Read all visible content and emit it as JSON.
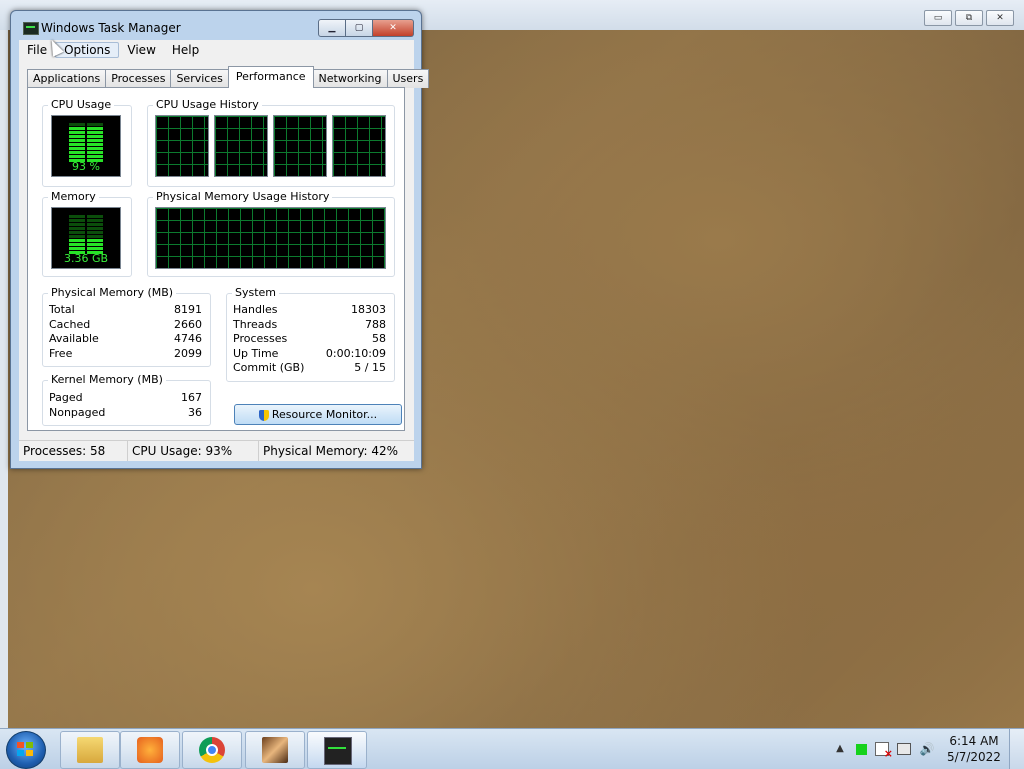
{
  "outer": {
    "controls": [
      "▭",
      "⧉",
      "✕"
    ]
  },
  "window": {
    "title": "Windows Task Manager",
    "controls": {
      "minimize": "▁",
      "maximize": "▢",
      "close": "✕"
    },
    "menu": [
      "File",
      "Options",
      "View",
      "Help"
    ],
    "tabs": [
      "Applications",
      "Processes",
      "Services",
      "Performance",
      "Networking",
      "Users"
    ],
    "active_tab": "Performance"
  },
  "performance": {
    "cpu_usage_label": "CPU Usage",
    "cpu_usage_value": "93 %",
    "cpu_usage_fraction": 0.93,
    "cpu_history_label": "CPU Usage History",
    "memory_label": "Memory",
    "memory_value": "3.36 GB",
    "memory_fraction": 0.42,
    "memory_history_label": "Physical Memory Usage History",
    "physical_memory": {
      "title": "Physical Memory (MB)",
      "rows": [
        {
          "label": "Total",
          "value": "8191"
        },
        {
          "label": "Cached",
          "value": "2660"
        },
        {
          "label": "Available",
          "value": "4746"
        },
        {
          "label": "Free",
          "value": "2099"
        }
      ]
    },
    "system": {
      "title": "System",
      "rows": [
        {
          "label": "Handles",
          "value": "18303"
        },
        {
          "label": "Threads",
          "value": "788"
        },
        {
          "label": "Processes",
          "value": "58"
        },
        {
          "label": "Up Time",
          "value": "0:00:10:09"
        },
        {
          "label": "Commit (GB)",
          "value": "5 / 15"
        }
      ]
    },
    "kernel_memory": {
      "title": "Kernel Memory (MB)",
      "rows": [
        {
          "label": "Paged",
          "value": "167"
        },
        {
          "label": "Nonpaged",
          "value": "36"
        }
      ]
    },
    "resource_monitor_button": "Resource Monitor..."
  },
  "statusbar": {
    "processes": "Processes: 58",
    "cpu": "CPU Usage: 93%",
    "memory": "Physical Memory: 42%"
  },
  "taskbar": {
    "clock_time": "6:14 AM",
    "clock_date": "5/7/2022",
    "tray_show_hidden": "▲",
    "tray_volume": "🔊"
  }
}
